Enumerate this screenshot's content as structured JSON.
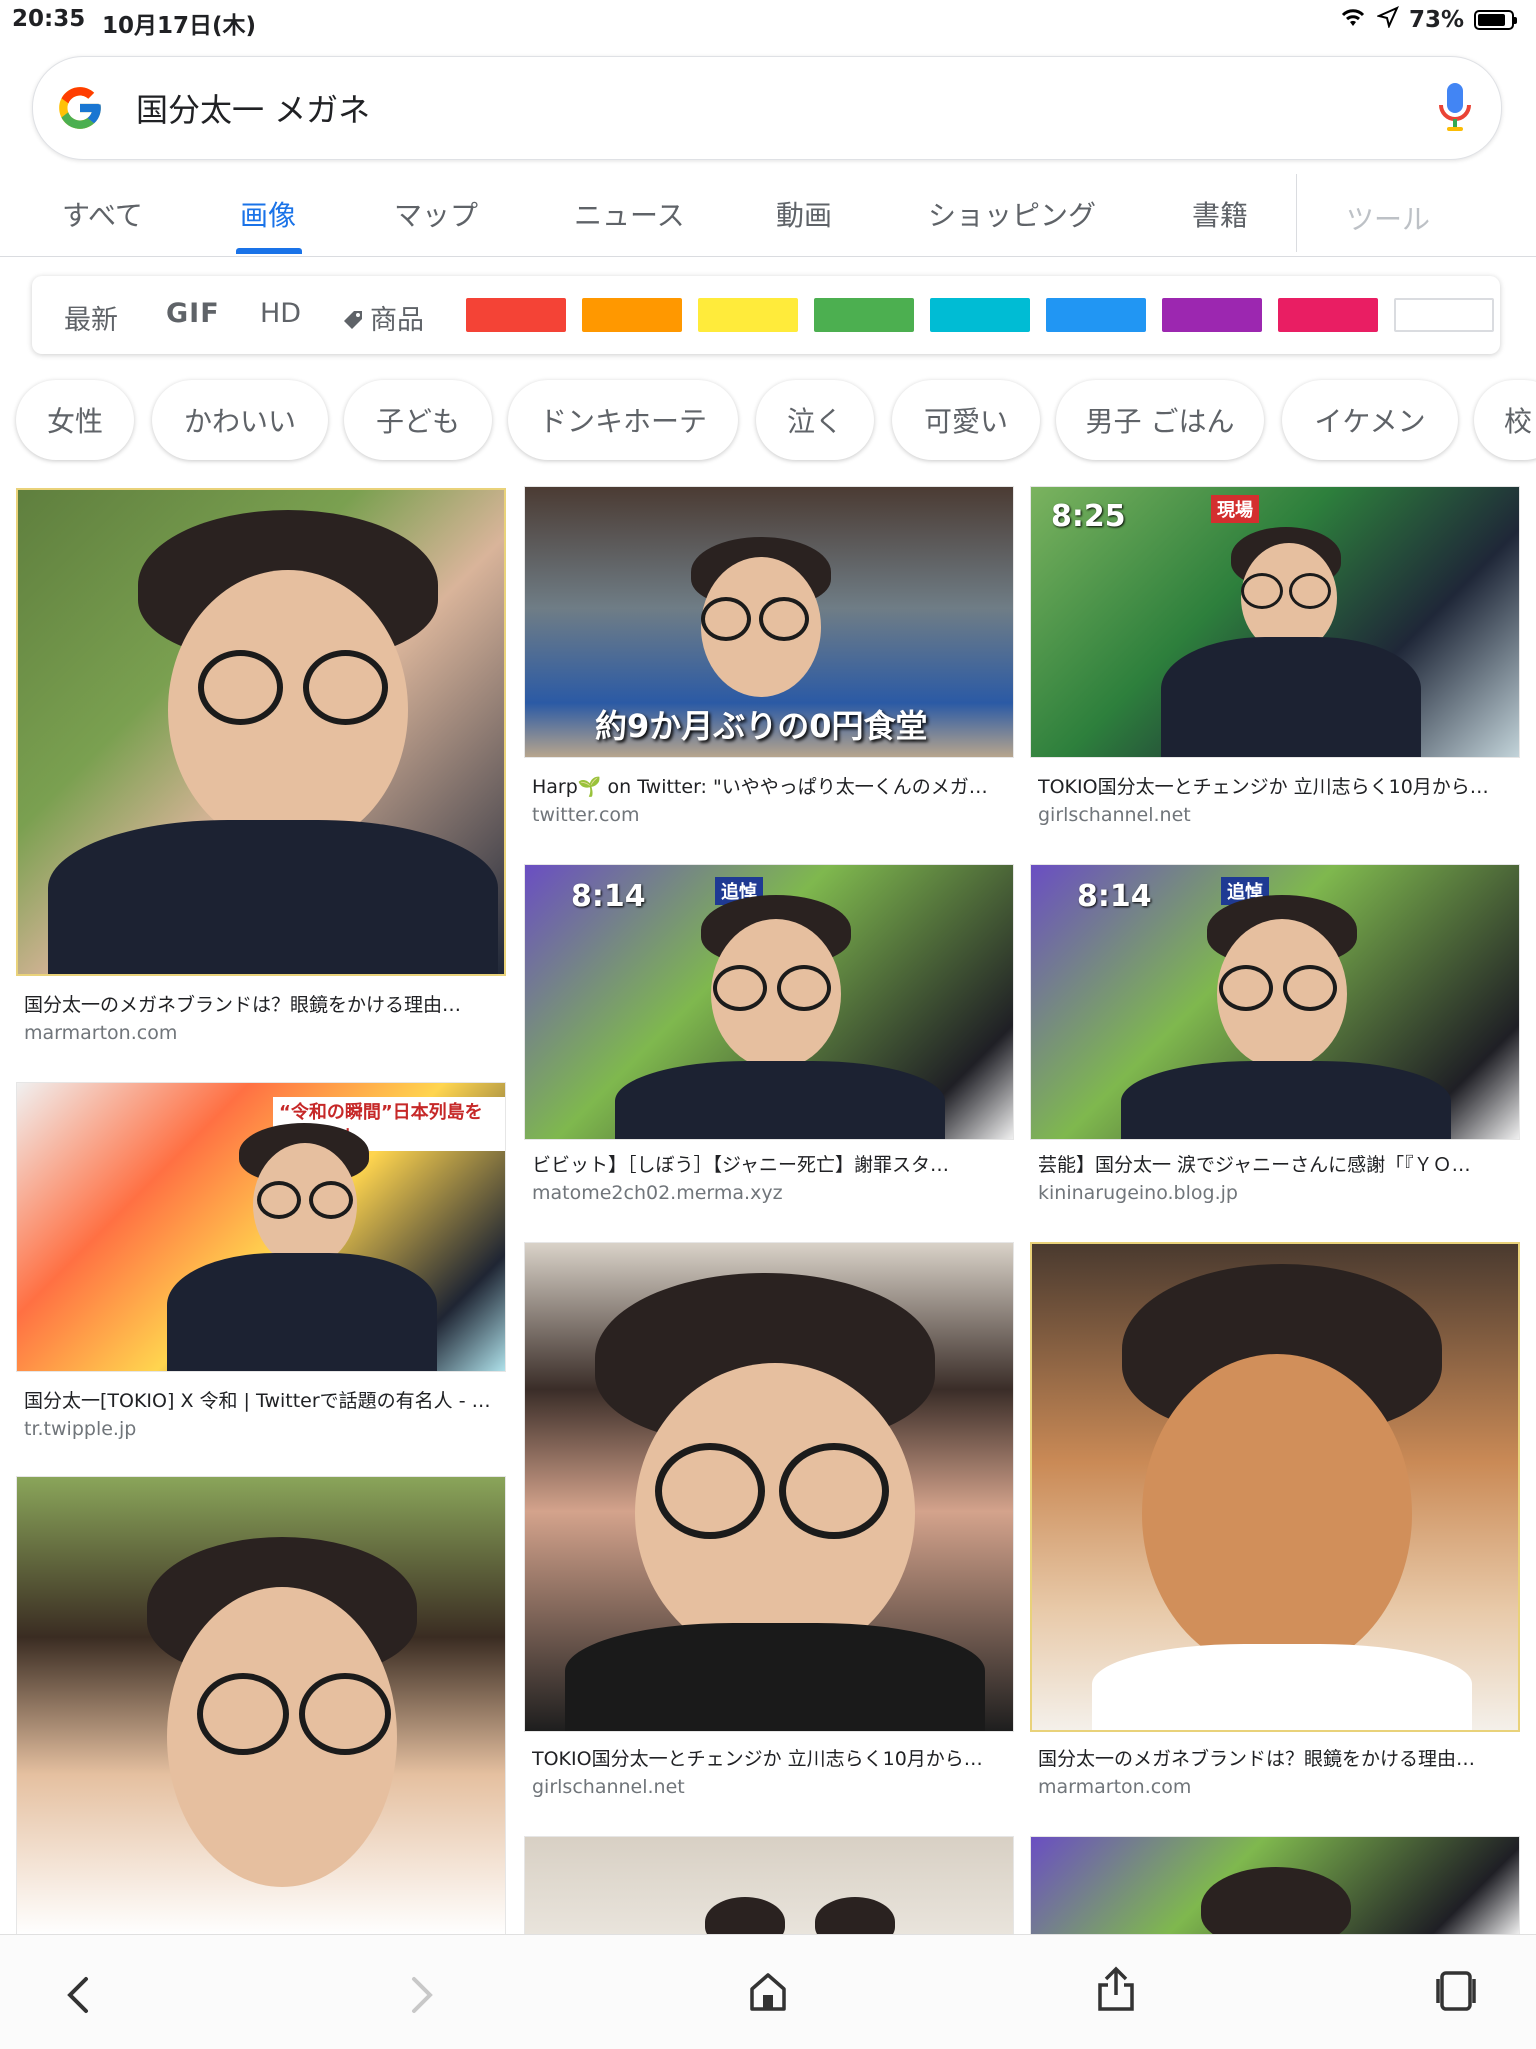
{
  "status": {
    "time": "20:35",
    "date": "10月17日(木)",
    "battery": "73%",
    "battery_level": 0.73
  },
  "search": {
    "query": "国分太一 メガネ"
  },
  "tabs": [
    {
      "label": "すべて",
      "active": false
    },
    {
      "label": "画像",
      "active": true
    },
    {
      "label": "マップ",
      "active": false
    },
    {
      "label": "ニュース",
      "active": false
    },
    {
      "label": "動画",
      "active": false
    },
    {
      "label": "ショッピング",
      "active": false
    },
    {
      "label": "書籍",
      "active": false
    },
    {
      "label": "ツール",
      "active": false
    }
  ],
  "filters": {
    "labels": [
      "最新",
      "GIF",
      "HD",
      "商品"
    ],
    "colors": [
      "#f44336",
      "#ff9800",
      "#ffeb3b",
      "#4caf50",
      "#00bcd4",
      "#2196f3",
      "#9c27b0",
      "#e91e63",
      "#ffffff"
    ]
  },
  "chips": [
    "女性",
    "かわいい",
    "子ども",
    "ドンキホーテ",
    "泣く",
    "可愛い",
    "男子 ごはん",
    "イケメン",
    "校"
  ],
  "results": [
    {
      "caption": "国分太一のメガネブランドは？眼鏡をかける理由…",
      "source": "marmarton.com"
    },
    {
      "caption": "Harp🌱 on Twitter: \"いややっぱり太一くんのメガ…",
      "source": "twitter.com",
      "overlay": "約9か月ぶりの0円食堂"
    },
    {
      "caption": "TOKIO国分太一とチェンジか 立川志らく10月から…",
      "source": "girlschannel.net",
      "overlay": "8:25"
    },
    {
      "caption": "ビビット】［しぼう］【ジャニー死亡】謝罪スタ…",
      "source": "matome2ch02.merma.xyz",
      "overlay": "8:14"
    },
    {
      "caption": "芸能】国分太一 涙でジャニーさんに感謝「『ＹＯ…",
      "source": "kininarugeino.blog.jp",
      "overlay": "8:14"
    },
    {
      "caption": "国分太一[TOKIO] X 令和 | Twitterで話題の有名人 - …",
      "source": "tr.twipple.jp",
      "overlay": "“令和の瞬間”日本列島を総力取材"
    },
    {
      "caption": "TOKIO国分太一とチェンジか 立川志らく10月から…",
      "source": "girlschannel.net"
    },
    {
      "caption": "国分太一のメガネブランドは？眼鏡をかける理由…",
      "source": "marmarton.com"
    }
  ],
  "toolbar": {
    "icons": [
      "back-icon",
      "forward-icon",
      "home-icon",
      "share-icon",
      "tabs-icon"
    ]
  }
}
